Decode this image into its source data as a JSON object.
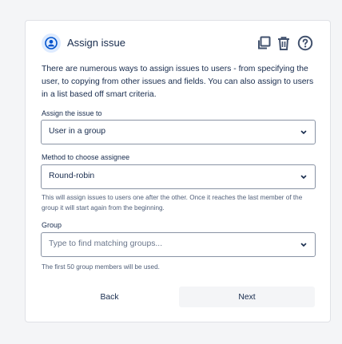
{
  "dialog": {
    "title": "Assign issue",
    "description": "There are numerous ways to assign issues to users - from specifying the user, to copying from other issues and fields. You can also assign to users in a list based off smart criteria."
  },
  "header_icons": [
    "user-icon",
    "copy-icon",
    "trash-icon",
    "help-icon"
  ],
  "fields": {
    "assign_to": {
      "label": "Assign the issue to",
      "value": "User in a group"
    },
    "method": {
      "label": "Method to choose assignee",
      "value": "Round-robin",
      "help": "This will assign issues to users one after the other. Once it reaches the last member of the group it will start again from the beginning."
    },
    "group": {
      "label": "Group",
      "placeholder": "Type to find matching groups...",
      "help": "The first 50 group members will be used."
    }
  },
  "buttons": {
    "back": "Back",
    "next": "Next"
  },
  "colors": {
    "accent": "#0052cc",
    "icon": "#42526e",
    "border": "#8993a4"
  }
}
